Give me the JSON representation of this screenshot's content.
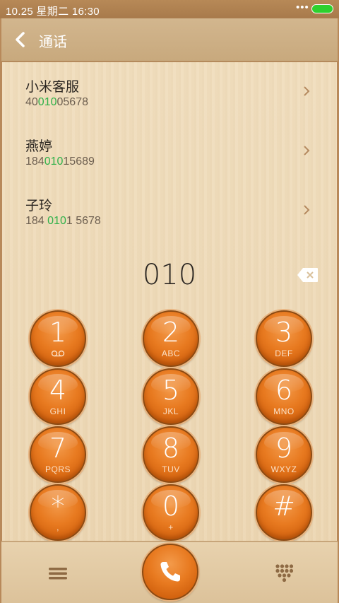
{
  "status_bar": {
    "time": "10.25  星期二   16:30",
    "dots": "•••"
  },
  "header": {
    "title": "通话"
  },
  "contacts": [
    {
      "name": "小米客服",
      "number_pre": "40",
      "number_hl": "010",
      "number_post": "05678"
    },
    {
      "name": "燕婷",
      "number_pre": "184",
      "number_hl": "010",
      "number_post": "15689"
    },
    {
      "name": "子玲",
      "number_pre": "184 ",
      "number_hl": "010",
      "number_post": "1 5678"
    }
  ],
  "dial": {
    "input": "010"
  },
  "keypad": [
    {
      "digit": "1",
      "letters": ""
    },
    {
      "digit": "2",
      "letters": "ABC"
    },
    {
      "digit": "3",
      "letters": "DEF"
    },
    {
      "digit": "4",
      "letters": "GHI"
    },
    {
      "digit": "5",
      "letters": "JKL"
    },
    {
      "digit": "6",
      "letters": "MNO"
    },
    {
      "digit": "7",
      "letters": "PQRS"
    },
    {
      "digit": "8",
      "letters": "TUV"
    },
    {
      "digit": "9",
      "letters": "WXYZ"
    },
    {
      "digit": "*",
      "letters": ","
    },
    {
      "digit": "0",
      "letters": "+"
    },
    {
      "digit": "#",
      "letters": ""
    }
  ],
  "colors": {
    "highlight": "#2fb14a",
    "key_orange": "#e87a20",
    "battery": "#2ed02e"
  },
  "icons": {
    "back": "chevron-left-icon",
    "backspace": "backspace-icon",
    "voicemail": "voicemail-icon",
    "menu": "menu-icon",
    "dialpad": "dialpad-icon",
    "call": "phone-icon"
  }
}
